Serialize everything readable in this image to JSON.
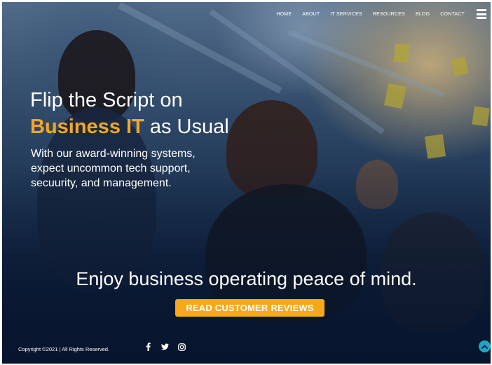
{
  "nav": {
    "items": [
      {
        "label": "HOME"
      },
      {
        "label": "ABOUT"
      },
      {
        "label": "IT SERVICES"
      },
      {
        "label": "RESOURCES"
      },
      {
        "label": "BLOG"
      },
      {
        "label": "CONTACT"
      }
    ],
    "menu_icon": "hamburger-icon"
  },
  "hero": {
    "headline_line1": "Flip the Script on",
    "headline_accent": "Business IT",
    "headline_rest": " as Usual",
    "subtext_line1": "With our award-winning systems,",
    "subtext_line2": "expect uncommon tech support,",
    "subtext_line3": "secuurity, and management."
  },
  "cta": {
    "tagline": "Enjoy business operating peace of mind.",
    "button_label": "READ CUSTOMER REVIEWS"
  },
  "footer": {
    "copyright": "Copyright ©2021  |  All Rights Reserved.",
    "social_icons": [
      "facebook-icon",
      "twitter-icon",
      "instagram-icon"
    ],
    "back_to_top_icon": "chevron-up-icon"
  },
  "colors": {
    "accent": "#f5a623",
    "button": "#f7a81b",
    "back_to_top": "#1fa5c4",
    "footer_bg": "#0b1a33"
  }
}
